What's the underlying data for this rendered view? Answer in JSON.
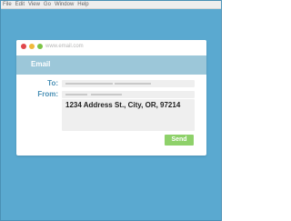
{
  "menu": {
    "items": [
      {
        "label": "File"
      },
      {
        "label": "Edit"
      },
      {
        "label": "View"
      },
      {
        "label": "Go"
      },
      {
        "label": "Window"
      },
      {
        "label": "Help"
      }
    ]
  },
  "browser": {
    "url": "www.email.com"
  },
  "email": {
    "header_title": "Email",
    "to_label": "To:",
    "from_label": "From:",
    "body_text": "1234 Address St., City, OR, 97214",
    "send_label": "Send"
  },
  "colors": {
    "background": "#5aa9d0",
    "header_band": "#9cc7d9",
    "label": "#4a90b5",
    "send_button": "#8ed16a",
    "close_dot": "#e0474c",
    "minimize_dot": "#f0b93a",
    "maximize_dot": "#7cc447"
  },
  "icons": {
    "close": "close-dot-icon",
    "minimize": "minimize-dot-icon",
    "maximize": "maximize-dot-icon"
  }
}
